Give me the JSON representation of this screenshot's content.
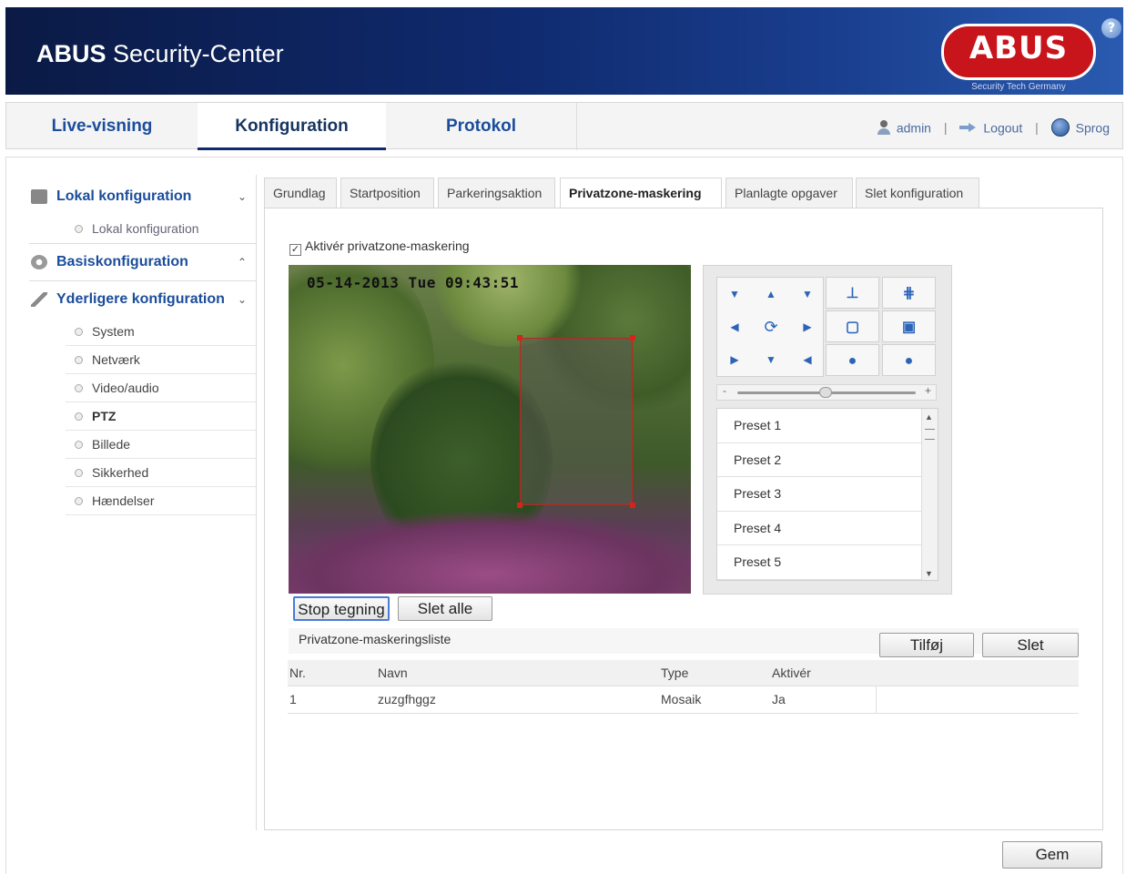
{
  "header": {
    "app_title_bold": "ABUS",
    "app_title_rest": "Security-Center",
    "logo_text": "ABUS",
    "logo_tagline": "Security Tech Germany",
    "help_icon": "?"
  },
  "nav": {
    "tabs": [
      {
        "label": "Live-visning"
      },
      {
        "label": "Konfiguration"
      },
      {
        "label": "Protokol"
      }
    ],
    "active_tab": "Konfiguration",
    "user": "admin",
    "logout": "Logout",
    "language": "Sprog",
    "separator": "|"
  },
  "sidebar": {
    "sections": [
      {
        "label": "Lokal konfiguration",
        "chevron": "⌄",
        "items": [
          {
            "label": "Lokal konfiguration"
          }
        ]
      },
      {
        "label": "Basiskonfiguration",
        "chevron": "⌃",
        "items": []
      },
      {
        "label": "Yderligere konfiguration",
        "chevron": "⌄",
        "items": [
          {
            "label": "System"
          },
          {
            "label": "Netværk"
          },
          {
            "label": "Video/audio"
          },
          {
            "label": "PTZ"
          },
          {
            "label": "Billede"
          },
          {
            "label": "Sikkerhed"
          },
          {
            "label": "Hændelser"
          }
        ]
      }
    ],
    "active_item": "PTZ"
  },
  "content_tabs": [
    {
      "label": "Grundlag"
    },
    {
      "label": "Startposition"
    },
    {
      "label": "Parkeringsaktion"
    },
    {
      "label": "Privatzone-maskering"
    },
    {
      "label": "Planlagte opgaver"
    },
    {
      "label": "Slet konfiguration"
    }
  ],
  "active_content_tab": "Privatzone-maskering",
  "privacy": {
    "enable_label": "Aktivér privatzone-maskering",
    "enable_checked": true,
    "check_mark": "✓",
    "timestamp": "05-14-2013 Tue 09:43:51",
    "stop_button": "Stop tegning",
    "delete_all_button": "Slet alle",
    "list_title": "Privatzone-maskeringsliste",
    "add_button": "Tilføj",
    "delete_button": "Slet",
    "table": {
      "headers": [
        "Nr.",
        "Navn",
        "Type",
        "Aktivér"
      ],
      "rows": [
        [
          "1",
          "zuzgfhggz",
          "Mosaik",
          "Ja"
        ]
      ]
    }
  },
  "ptz": {
    "presets": [
      "Preset 1",
      "Preset 2",
      "Preset 3",
      "Preset 4",
      "Preset 5"
    ],
    "slider_minus": "-",
    "slider_plus": "+",
    "scroll_up": "▲",
    "scroll_down": "▼",
    "direction_icons": [
      "▼",
      "▲",
      "▼",
      "◀",
      "⟳",
      "▶",
      "▶",
      "▼",
      "◀"
    ],
    "zoom_icons": [
      "focus-near-icon",
      "focus-far-icon",
      "iris-close-icon",
      "iris-open-icon",
      "zoom-in-icon",
      "zoom-out-icon"
    ]
  },
  "footer": {
    "save_button": "Gem"
  },
  "colors": {
    "header_dark": "#0b1a45",
    "header_light": "#2a5bb0",
    "link_blue": "#1b4d9c",
    "logo_red": "#c8141b",
    "mask_border": "#c0231e"
  }
}
